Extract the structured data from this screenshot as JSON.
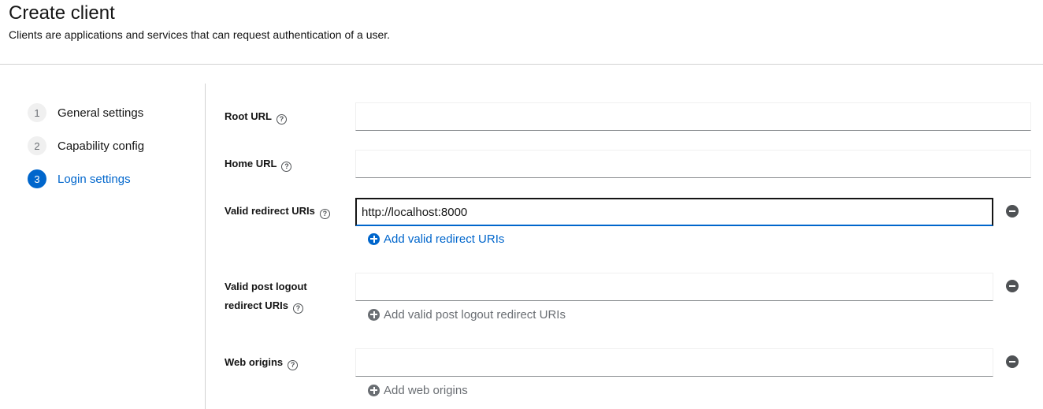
{
  "header": {
    "title": "Create client",
    "subtitle": "Clients are applications and services that can request authentication of a user."
  },
  "wizard": {
    "steps": [
      {
        "number": "1",
        "label": "General settings"
      },
      {
        "number": "2",
        "label": "Capability config"
      },
      {
        "number": "3",
        "label": "Login settings"
      }
    ],
    "current_step": "Login settings"
  },
  "form": {
    "root_url": {
      "label": "Root URL",
      "value": ""
    },
    "home_url": {
      "label": "Home URL",
      "value": ""
    },
    "valid_redirect_uris": {
      "label": "Valid redirect URIs",
      "value": "http://localhost:8000",
      "add_label": "Add valid redirect URIs"
    },
    "valid_post_logout_redirect_uris": {
      "label_line1": "Valid post logout",
      "label_line2": "redirect URIs",
      "value": "",
      "add_label": "Add valid post logout redirect URIs"
    },
    "web_origins": {
      "label": "Web origins",
      "value": "",
      "add_label": "Add web origins"
    },
    "help_glyph": "?"
  },
  "icons": {
    "help": "help-circle-icon",
    "remove": "minus-circle-icon",
    "add": "plus-circle-icon"
  },
  "colors": {
    "accent": "#0066cc",
    "muted": "#6a6e73",
    "border": "#d2d2d2"
  }
}
